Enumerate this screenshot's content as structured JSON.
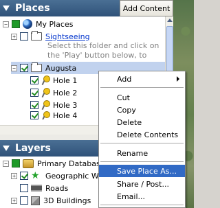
{
  "places": {
    "title": "Places",
    "add_content_label": "Add Content",
    "items": [
      {
        "label": "My Places"
      },
      {
        "label": "Sightseeing",
        "description": "Select this folder and click on the 'Play' button below, to start the"
      },
      {
        "label": "Augusta"
      },
      {
        "label": "Hole 1"
      },
      {
        "label": "Hole 2"
      },
      {
        "label": "Hole 3"
      },
      {
        "label": "Hole 4"
      }
    ]
  },
  "layers": {
    "title": "Layers",
    "items": [
      {
        "label": "Primary Database"
      },
      {
        "label": "Geographic Web"
      },
      {
        "label": "Roads"
      },
      {
        "label": "3D Buildings"
      }
    ]
  },
  "context_menu": {
    "items": [
      {
        "label": "Add",
        "submenu": true
      },
      {
        "label": "Cut"
      },
      {
        "label": "Copy"
      },
      {
        "label": "Delete"
      },
      {
        "label": "Delete Contents"
      },
      {
        "label": "Rename"
      },
      {
        "label": "Save Place As...",
        "highlighted": true
      },
      {
        "label": "Share / Post..."
      },
      {
        "label": "Email..."
      }
    ]
  },
  "colors": {
    "header_bg": "#2f5279",
    "selection": "#c1d2ee",
    "menu_highlight": "#316ac5",
    "link": "#0033cc"
  }
}
